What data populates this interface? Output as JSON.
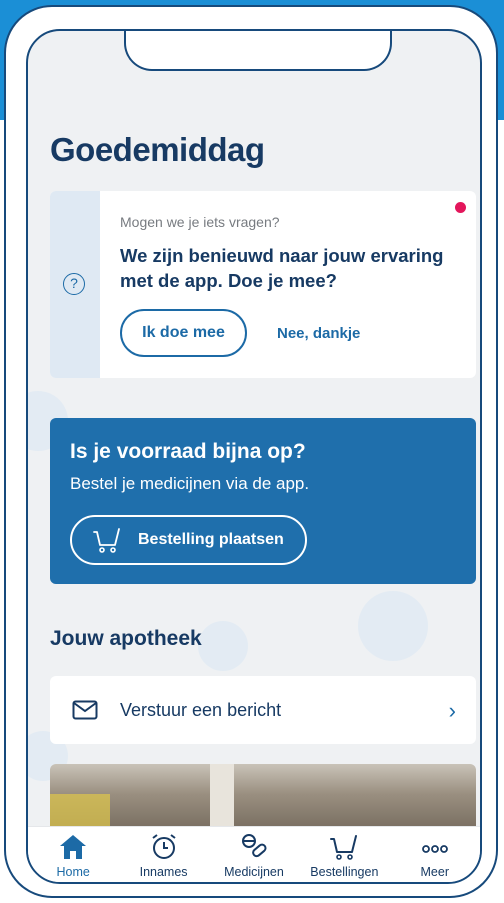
{
  "greeting": "Goedemiddag",
  "survey": {
    "kicker": "Mogen we je iets vragen?",
    "question": "We zijn benieuwd naar jouw ervaring met de app. Doe je mee?",
    "accept_label": "Ik doe mee",
    "decline_label": "Nee, dankje",
    "help_glyph": "?"
  },
  "promo": {
    "title": "Is je voorraad bijna op?",
    "subtitle": "Bestel je medicijnen via de app.",
    "button_label": "Bestelling plaatsen"
  },
  "pharmacy": {
    "section_title": "Jouw apotheek",
    "message_label": "Verstuur een bericht"
  },
  "tabbar": {
    "items": [
      {
        "label": "Home",
        "icon": "home-icon",
        "active": true
      },
      {
        "label": "Innames",
        "icon": "alarm-clock-icon",
        "active": false
      },
      {
        "label": "Medicijnen",
        "icon": "pills-icon",
        "active": false
      },
      {
        "label": "Bestellingen",
        "icon": "cart-icon",
        "active": false
      },
      {
        "label": "Meer",
        "icon": "more-icon",
        "active": false
      }
    ]
  },
  "colors": {
    "brand_dark": "#173a63",
    "brand": "#1c6aa6",
    "promo_bg": "#1f6fac",
    "notification": "#e3165b"
  }
}
